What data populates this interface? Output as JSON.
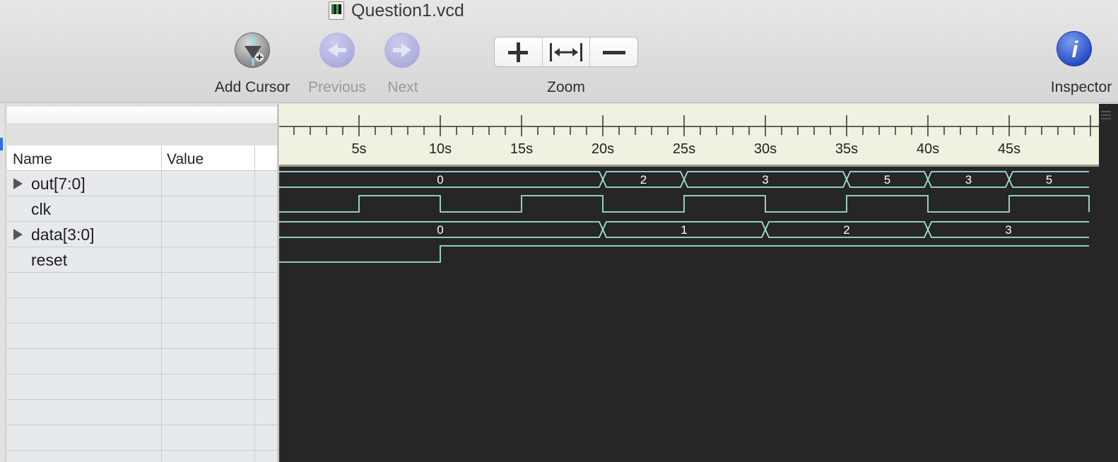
{
  "window": {
    "title": "Question1.vcd",
    "file_icon": "vcd-file-icon"
  },
  "toolbar": {
    "add_cursor": {
      "label": "Add Cursor",
      "icon": "add-cursor-icon"
    },
    "previous": {
      "label": "Previous",
      "icon": "previous-arrow-icon",
      "enabled": false
    },
    "next": {
      "label": "Next",
      "icon": "next-arrow-icon",
      "enabled": false
    },
    "zoom": {
      "label": "Zoom",
      "buttons": [
        "zoom-in",
        "zoom-fit",
        "zoom-out"
      ]
    },
    "inspector": {
      "label": "Inspector",
      "icon": "info-icon"
    }
  },
  "signal_table": {
    "headers": {
      "name": "Name",
      "value": "Value"
    },
    "signals": [
      {
        "name": "out[7:0]",
        "expandable": true,
        "value": ""
      },
      {
        "name": "clk",
        "expandable": false,
        "value": ""
      },
      {
        "name": "data[3:0]",
        "expandable": true,
        "value": ""
      },
      {
        "name": "reset",
        "expandable": false,
        "value": ""
      }
    ]
  },
  "ruler": {
    "tick_labels": [
      "5s",
      "10s",
      "15s",
      "20s",
      "25s",
      "30s",
      "35s",
      "40s",
      "45s"
    ]
  },
  "waveforms": {
    "time_range": [
      0,
      50
    ],
    "out": {
      "type": "bus",
      "segments": [
        {
          "start": 0,
          "end": 20,
          "value": "0"
        },
        {
          "start": 20,
          "end": 25,
          "value": "2"
        },
        {
          "start": 25,
          "end": 35,
          "value": "3"
        },
        {
          "start": 35,
          "end": 40,
          "value": "5"
        },
        {
          "start": 40,
          "end": 45,
          "value": "3"
        },
        {
          "start": 45,
          "end": 50,
          "value": "5"
        }
      ]
    },
    "clk": {
      "type": "bit",
      "transitions": [
        {
          "t": 0,
          "v": 0
        },
        {
          "t": 5,
          "v": 1
        },
        {
          "t": 10,
          "v": 0
        },
        {
          "t": 15,
          "v": 1
        },
        {
          "t": 20,
          "v": 0
        },
        {
          "t": 25,
          "v": 1
        },
        {
          "t": 30,
          "v": 0
        },
        {
          "t": 35,
          "v": 1
        },
        {
          "t": 40,
          "v": 0
        },
        {
          "t": 45,
          "v": 1
        }
      ]
    },
    "data": {
      "type": "bus",
      "segments": [
        {
          "start": 0,
          "end": 20,
          "value": "0"
        },
        {
          "start": 20,
          "end": 30,
          "value": "1"
        },
        {
          "start": 30,
          "end": 40,
          "value": "2"
        },
        {
          "start": 40,
          "end": 50,
          "value": "3"
        }
      ]
    },
    "reset": {
      "type": "bit",
      "transitions": [
        {
          "t": 0,
          "v": 0
        },
        {
          "t": 10,
          "v": 1
        }
      ]
    }
  },
  "colors": {
    "wave": "#9fe3d4",
    "wave_bg": "#262626",
    "ruler_bg": "#f1f1e1",
    "inspector_blue": "#2a4fc4"
  }
}
